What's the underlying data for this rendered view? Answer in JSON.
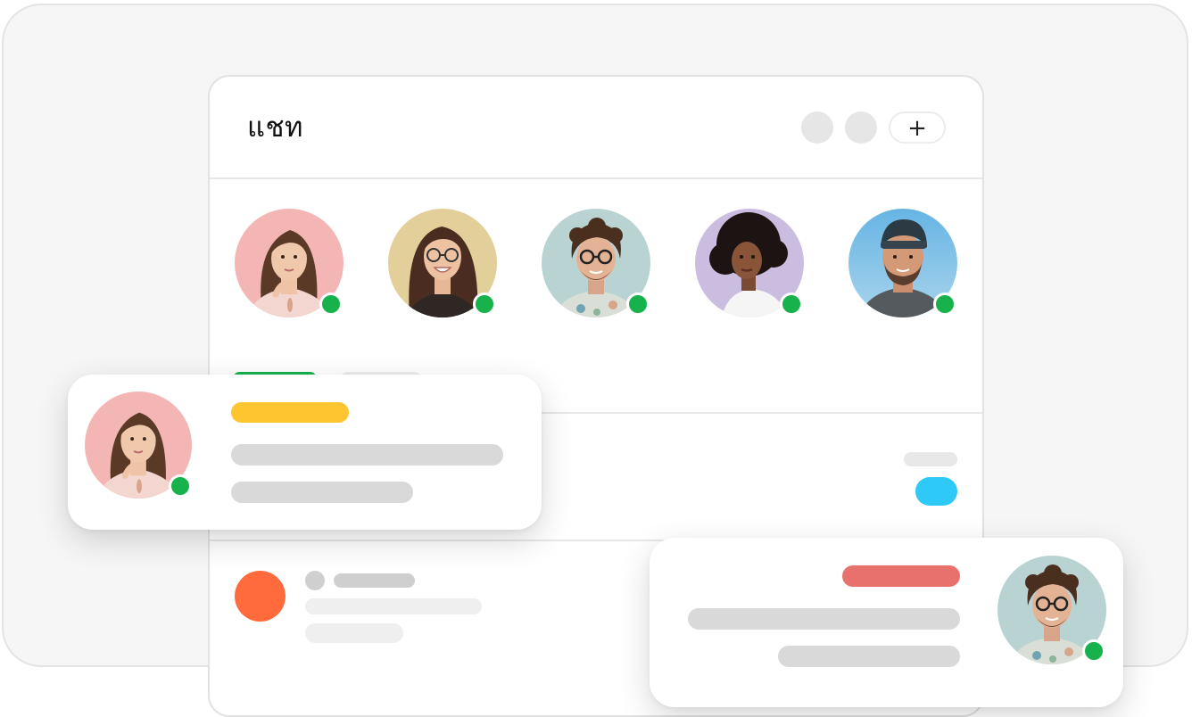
{
  "app": {
    "title": "แชท",
    "header_buttons": [
      {
        "icon": "circle-placeholder-icon"
      },
      {
        "icon": "circle-placeholder-icon"
      },
      {
        "icon": "plus-icon",
        "label": "+"
      }
    ]
  },
  "stories": {
    "contacts": [
      {
        "avatar_bg": "#f4b5b5",
        "status": "online"
      },
      {
        "avatar_bg": "#e3cf9a",
        "status": "online"
      },
      {
        "avatar_bg": "#b9d3d3",
        "status": "online"
      },
      {
        "avatar_bg": "#cbbde0",
        "status": "online"
      },
      {
        "avatar_bg": "#8ac4e3",
        "status": "online"
      }
    ]
  },
  "colors": {
    "online": "#17b24b",
    "accent_yellow": "#fdc530",
    "accent_red": "#e8716b",
    "accent_cyan": "#2fc9f7",
    "accent_orange": "#ff6b3d",
    "placeholder": "#d9d9d9",
    "placeholder_light": "#efefef"
  }
}
